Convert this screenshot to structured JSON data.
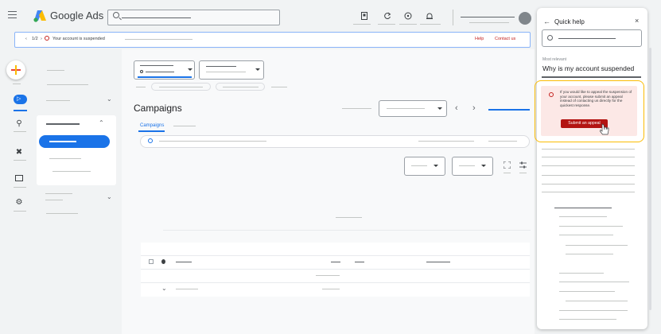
{
  "app": {
    "name": "Google Ads",
    "brand_colors": {
      "blue": "#4285f4",
      "yellow": "#fbbc04",
      "green": "#34a853"
    }
  },
  "notification": {
    "pager": "1/2",
    "message": "Your account is suspended",
    "help_link": "Help",
    "contact_link": "Contact us"
  },
  "main": {
    "page_title": "Campaigns",
    "tab_campaigns": "Campaigns"
  },
  "quick_help": {
    "title": "Quick help",
    "back_icon": "arrow-left-icon",
    "close_icon": "close-icon",
    "section_label": "Most relevant",
    "article_title": "Why is my account suspended",
    "alert_text": "If you would like to appeal the suspension of your account, please submit an appeal instead of contacting us directly for the quickest response.",
    "appeal_button": "Submit an appeal",
    "highlight_color": "#fbbc04",
    "alert_bg": "#fce8e6",
    "button_color": "#b31412"
  }
}
